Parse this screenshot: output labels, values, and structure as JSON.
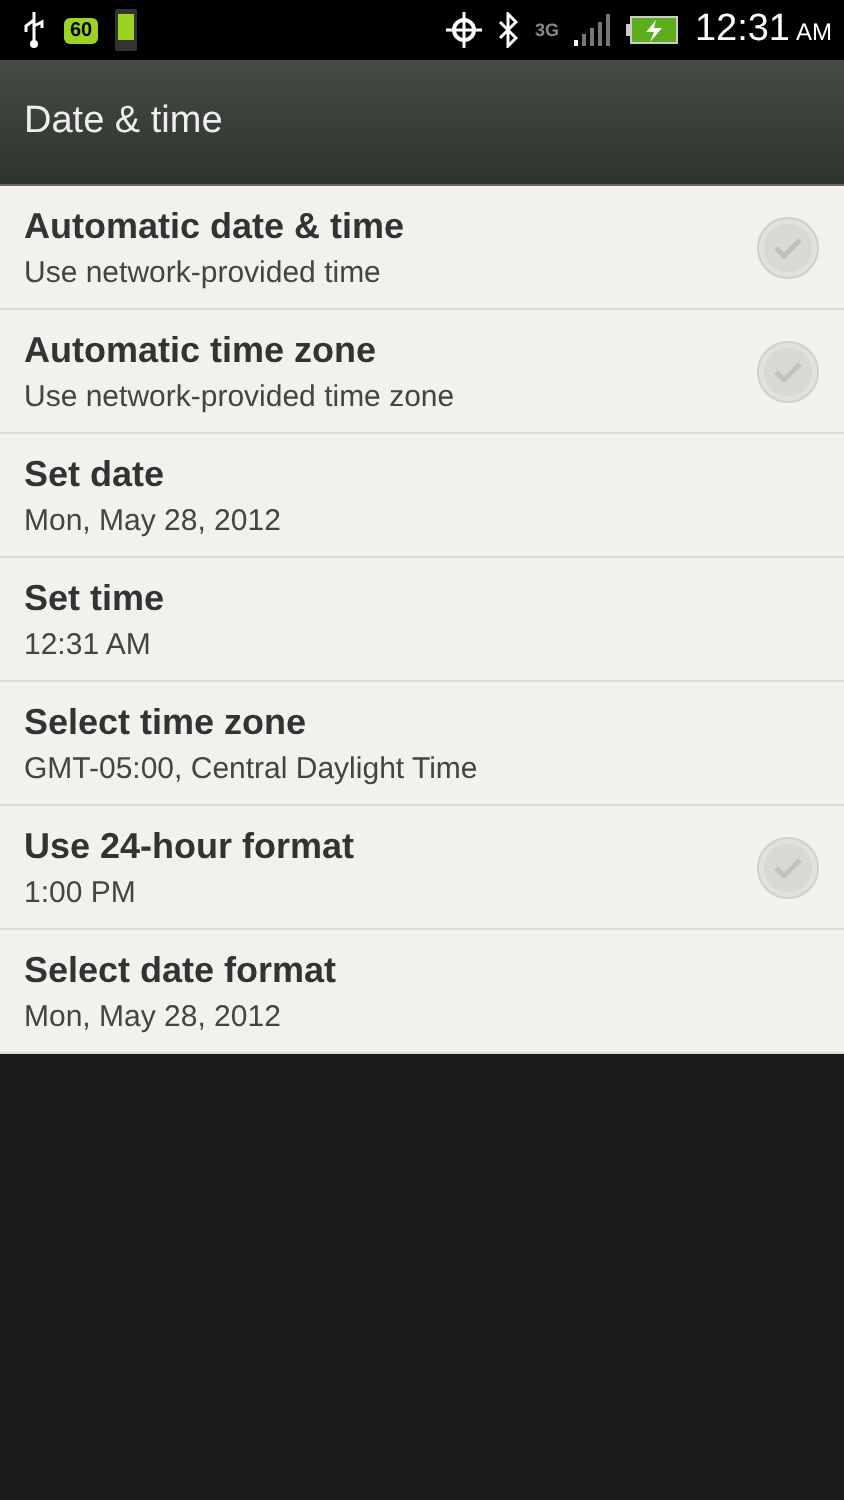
{
  "status_bar": {
    "battery_badge": "60",
    "network": "3G",
    "time": "12:31",
    "ampm": "AM"
  },
  "header": {
    "title": "Date & time"
  },
  "settings": [
    {
      "kind": "check",
      "title": "Automatic date & time",
      "summary": "Use network-provided time",
      "checked": false
    },
    {
      "kind": "check",
      "title": "Automatic time zone",
      "summary": "Use network-provided time zone",
      "checked": false
    },
    {
      "kind": "plain",
      "title": "Set date",
      "summary": "Mon, May 28, 2012"
    },
    {
      "kind": "plain",
      "title": "Set time",
      "summary": "12:31 AM"
    },
    {
      "kind": "plain",
      "title": "Select time zone",
      "summary": "GMT-05:00, Central Daylight Time"
    },
    {
      "kind": "check",
      "title": "Use 24-hour format",
      "summary": "1:00 PM",
      "checked": false
    },
    {
      "kind": "plain",
      "title": "Select date format",
      "summary": "Mon, May 28, 2012"
    }
  ]
}
